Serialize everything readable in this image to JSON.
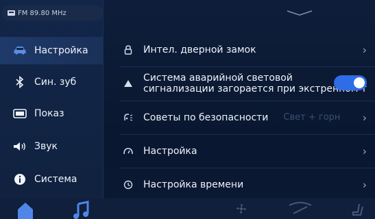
{
  "status": {
    "radio_label": "FM 89.80 MHz"
  },
  "sidebar": {
    "items": [
      {
        "label": "Настройка",
        "icon": "car-icon",
        "active": true
      },
      {
        "label": "Син. зуб",
        "icon": "bluetooth-icon",
        "active": false
      },
      {
        "label": "Показ",
        "icon": "display-icon",
        "active": false
      },
      {
        "label": "Звук",
        "icon": "speaker-icon",
        "active": false
      },
      {
        "label": "Система",
        "icon": "info-icon",
        "active": false
      }
    ]
  },
  "main": {
    "rows": [
      {
        "label": "Интел. дверной замок",
        "icon": "lock-icon"
      },
      {
        "label_line1": "Система аварийной световой",
        "label_line2": "сигнализации загорается при экстренном т",
        "icon": "warning-icon",
        "toggle_on": true
      },
      {
        "label": "Советы по безопасности",
        "hint": "Свет + горн",
        "icon": "safety-tips-icon"
      },
      {
        "label": "Настройка",
        "icon": "gauge-icon"
      },
      {
        "label": "Настройка времени",
        "icon": "clock-icon"
      }
    ]
  },
  "colors": {
    "accent": "#2e6de6",
    "background": "#0b1a33",
    "sidebar_active": "#1e3a6a"
  },
  "bottom_bar": {
    "icons": [
      "home-icon",
      "music-icon",
      "fan-icon",
      "wiper-icon",
      "seat-icon"
    ]
  }
}
